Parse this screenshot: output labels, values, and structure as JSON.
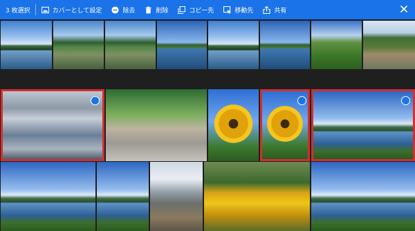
{
  "toolbar": {
    "selected_count": "3 枚選択",
    "actions": [
      {
        "label": "カバーとして設定",
        "icon": "image-icon"
      },
      {
        "label": "除去",
        "icon": "remove-icon"
      },
      {
        "label": "削除",
        "icon": "trash-icon"
      },
      {
        "label": "コピー先",
        "icon": "copy-icon"
      },
      {
        "label": "移動先",
        "icon": "move-icon"
      },
      {
        "label": "共有",
        "icon": "share-icon"
      }
    ],
    "close_icon": "close-icon",
    "bar_color": "#1a73e8"
  },
  "photos": {
    "selected_border_color": "#d32f2f",
    "check_color": "#1a73e8",
    "row1": [
      "lake",
      "marsh-pond",
      "marsh-pond",
      "lake-reflection",
      "forest-lake",
      "lake-mountain",
      "green-field",
      "waterfall"
    ],
    "row2": [
      "bear-in-river",
      "rocky-shore",
      "sunflower",
      "sunflower",
      "caldera-lake"
    ],
    "row3": [
      "caldera-lake",
      "caldera-lake",
      "steam-vent",
      "sunflower-field",
      "caldera-lake"
    ],
    "selected": [
      "bear-in-river",
      "sunflower-2",
      "caldera-lake-1"
    ]
  }
}
